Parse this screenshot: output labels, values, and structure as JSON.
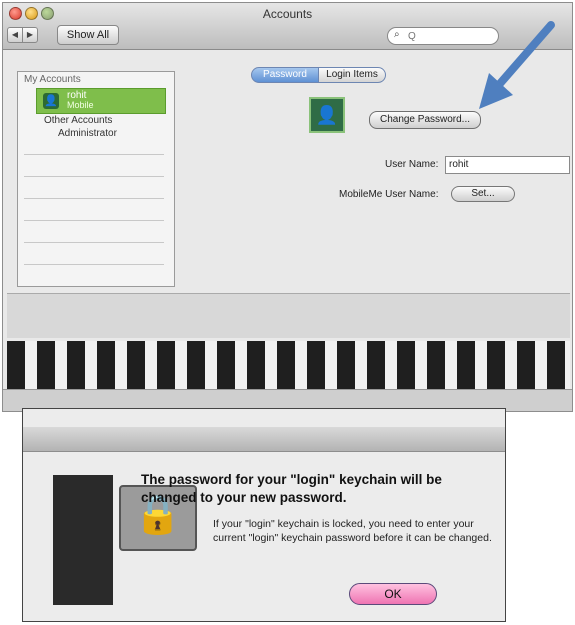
{
  "window": {
    "title": "Accounts",
    "show_all_label": "Show All",
    "search_placeholder": "Q",
    "search_icon": "magnifier-icon"
  },
  "account_list": {
    "heading": "My Accounts",
    "selected_account": {
      "name": "rohit",
      "type": "Mobile"
    },
    "other_accounts_label": "Other Accounts",
    "admin_label": "Administrator"
  },
  "tabs": [
    {
      "label": "Password",
      "selected": true
    },
    {
      "label": "Login Items",
      "selected": false
    }
  ],
  "user_detail": {
    "change_password_label": "Change Password...",
    "user_name_label": "User Name:",
    "user_name_value": "rohit",
    "mobileme_label": "MobileMe User Name:",
    "set_button_label": "Set..."
  },
  "alert": {
    "message": "The password for your \"login\" keychain will be changed to your new password.",
    "info": "If your \"login\" keychain is locked, you need to enter your current \"login\" keychain password before it can be changed.",
    "ok_label": "OK",
    "icon": "keychain-lock-icon"
  },
  "colors": {
    "selected_row": "#7fbe4b",
    "tab_selected": "#5f91d4",
    "ok_button": "#ef74b2",
    "arrow": "#4f7fbf"
  }
}
